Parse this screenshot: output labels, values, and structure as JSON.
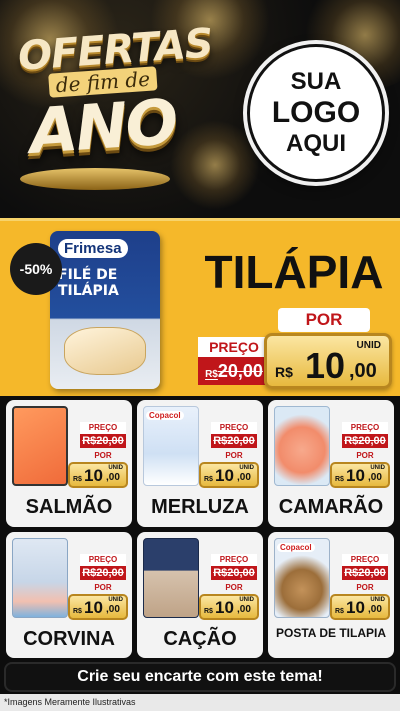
{
  "header": {
    "promo_line1": "OFERTAS",
    "promo_line2": "de fim de",
    "promo_line3": "ANO",
    "logo_line1": "SUA",
    "logo_line2": "LOGO",
    "logo_line3": "AQUI"
  },
  "hero": {
    "discount": "-50%",
    "brand": "Frimesa",
    "pack_title": "FILÉ DE TILÁPIA",
    "name": "TILÁPIA",
    "preco_label": "PREÇO",
    "old_currency": "R$",
    "old_price": "20,00",
    "por_label": "POR",
    "unid_label": "UNID",
    "new_currency": "R$",
    "new_int": "10",
    "new_dec": ",00"
  },
  "products": [
    {
      "name": "SALMÃO",
      "brand": "",
      "preco_label": "PREÇO",
      "old_price": "R$20,00",
      "por_label": "POR",
      "unid_label": "UNID",
      "currency": "R$",
      "price_int": "10",
      "price_dec": ",00"
    },
    {
      "name": "MERLUZA",
      "brand": "Copacol",
      "preco_label": "PREÇO",
      "old_price": "R$20,00",
      "por_label": "POR",
      "unid_label": "UNID",
      "currency": "R$",
      "price_int": "10",
      "price_dec": ",00"
    },
    {
      "name": "CAMARÃO",
      "brand": "",
      "preco_label": "PREÇO",
      "old_price": "R$20,00",
      "por_label": "POR",
      "unid_label": "UNID",
      "currency": "R$",
      "price_int": "10",
      "price_dec": ",00"
    },
    {
      "name": "CORVINA",
      "brand": "",
      "preco_label": "PREÇO",
      "old_price": "R$20,00",
      "por_label": "POR",
      "unid_label": "UNID",
      "currency": "R$",
      "price_int": "10",
      "price_dec": ",00"
    },
    {
      "name": "CAÇÃO",
      "brand": "",
      "preco_label": "PREÇO",
      "old_price": "R$20,00",
      "por_label": "POR",
      "unid_label": "UNID",
      "currency": "R$",
      "price_int": "10",
      "price_dec": ",00"
    },
    {
      "name": "POSTA DE TILAPIA",
      "brand": "Copacol",
      "preco_label": "PREÇO",
      "old_price": "R$20,00",
      "por_label": "POR",
      "unid_label": "UNID",
      "currency": "R$",
      "price_int": "10",
      "price_dec": ",00"
    }
  ],
  "footer": {
    "cta": "Crie seu encarte com este tema!",
    "disclaimer": "*Imagens Meramente Ilustrativas"
  },
  "colors": {
    "hero_bg": "#f5b82a",
    "price_red": "#c0161a",
    "gold": "#e7b93e",
    "background": "#0d0d0d"
  }
}
